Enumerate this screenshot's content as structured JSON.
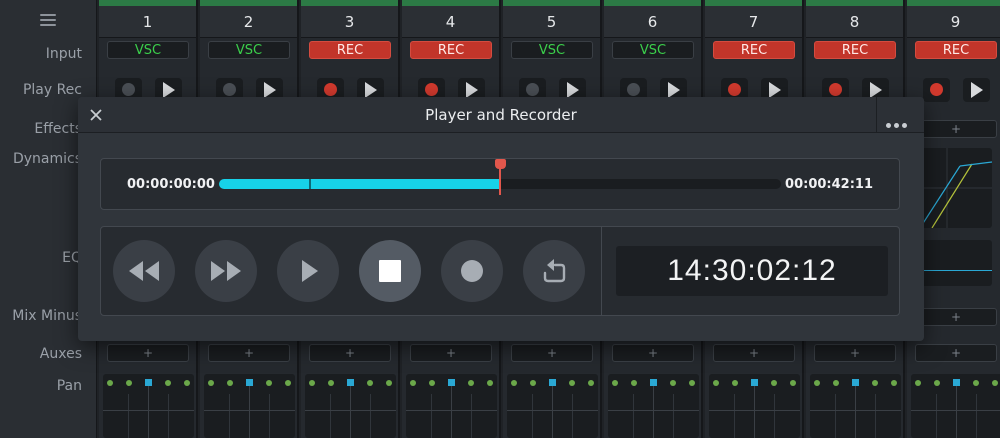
{
  "sidebar": {
    "menu_icon": "hamburger-icon",
    "labels": {
      "input": "Input",
      "play_rec": "Play Rec",
      "effects": "Effects",
      "dynamics": "Dynamics",
      "eq": "EQ",
      "mix_minus": "Mix Minus",
      "auxes": "Auxes",
      "pan": "Pan"
    }
  },
  "channels": [
    {
      "number": "1",
      "input": "VSC",
      "input_type": "vsc",
      "record_armed": false
    },
    {
      "number": "2",
      "input": "VSC",
      "input_type": "vsc",
      "record_armed": false
    },
    {
      "number": "3",
      "input": "REC",
      "input_type": "rec",
      "record_armed": true
    },
    {
      "number": "4",
      "input": "REC",
      "input_type": "rec",
      "record_armed": true
    },
    {
      "number": "5",
      "input": "VSC",
      "input_type": "vsc",
      "record_armed": false
    },
    {
      "number": "6",
      "input": "VSC",
      "input_type": "vsc",
      "record_armed": false
    },
    {
      "number": "7",
      "input": "REC",
      "input_type": "rec",
      "record_armed": true
    },
    {
      "number": "8",
      "input": "REC",
      "input_type": "rec",
      "record_armed": true
    },
    {
      "number": "9",
      "input": "REC",
      "input_type": "rec",
      "record_armed": true
    }
  ],
  "add_symbol": "+",
  "dialog": {
    "title": "Player and Recorder",
    "close_icon": "close-icon",
    "more_icon": "more-icon",
    "timeline": {
      "start_timecode": "00:00:00:00",
      "end_timecode": "00:00:42:11",
      "progress": 0.5,
      "marker_position": 0.16
    },
    "transport": {
      "buttons": [
        {
          "id": "rewind",
          "icon": "rewind-icon"
        },
        {
          "id": "fast_forward",
          "icon": "fast-forward-icon"
        },
        {
          "id": "play",
          "icon": "play-icon"
        },
        {
          "id": "stop",
          "icon": "stop-icon",
          "active": true
        },
        {
          "id": "record",
          "icon": "record-icon"
        },
        {
          "id": "loop",
          "icon": "loop-icon"
        }
      ],
      "clock": "14:30:02:12"
    }
  },
  "colors": {
    "accent_cyan": "#17d2e8",
    "playhead_red": "#e2574c",
    "rec_red": "#c2352a",
    "vsc_green": "#3bcf4b",
    "channel_top_green": "#2c7a45"
  }
}
